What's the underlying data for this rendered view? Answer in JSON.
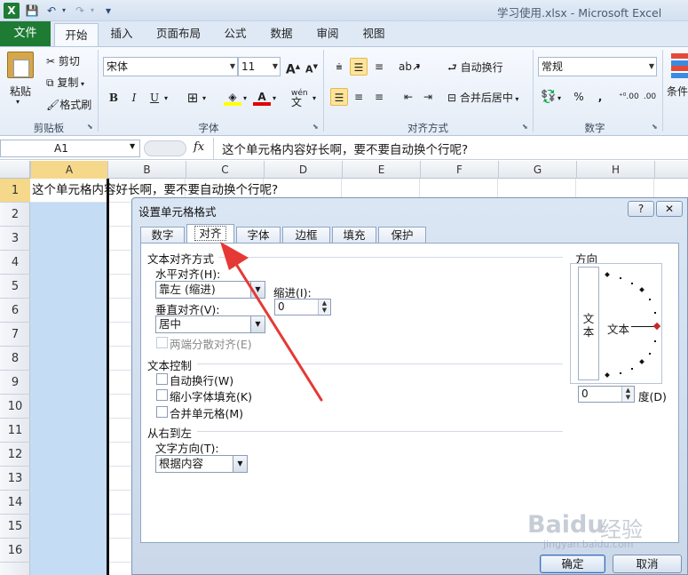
{
  "window": {
    "title": "学习使用.xlsx - Microsoft Excel"
  },
  "quick_access": {
    "save": "💾",
    "undo": "↶",
    "redo": "↷",
    "customize": "▾"
  },
  "ribbon_tabs": [
    {
      "label": "文件"
    },
    {
      "label": "开始"
    },
    {
      "label": "插入"
    },
    {
      "label": "页面布局"
    },
    {
      "label": "公式"
    },
    {
      "label": "数据"
    },
    {
      "label": "审阅"
    },
    {
      "label": "视图"
    }
  ],
  "clipboard": {
    "paste": "粘贴",
    "cut": "剪切",
    "copy": "复制",
    "format_painter": "格式刷",
    "group": "剪贴板"
  },
  "font": {
    "name": "宋体",
    "size": "11",
    "bold": "B",
    "italic": "I",
    "underline": "U",
    "group": "字体",
    "grow": "A",
    "shrink": "A",
    "color_letter": "A",
    "wen": "wén"
  },
  "alignment": {
    "wrap_text": "自动换行",
    "merge_center": "合并后居中",
    "group": "对齐方式"
  },
  "number": {
    "format": "常规",
    "group": "数字",
    "percent": "%",
    "comma": ","
  },
  "styles": {
    "label": "条件"
  },
  "formula_bar": {
    "cell_ref": "A1",
    "fx": "fx",
    "content": "这个单元格内容好长啊，要不要自动换个行呢?"
  },
  "columns": [
    "A",
    "B",
    "C",
    "D",
    "E",
    "F",
    "G",
    "H"
  ],
  "rows": [
    "1",
    "2",
    "3",
    "4",
    "5",
    "6",
    "7",
    "8",
    "9",
    "10",
    "11",
    "12",
    "13",
    "14",
    "15",
    "16"
  ],
  "cell_a1": "这个单元格内容好长啊，要不要自动换个行呢?",
  "dialog": {
    "title": "设置单元格格式",
    "help": "?",
    "close": "✕",
    "tabs": [
      {
        "label": "数字"
      },
      {
        "label": "对齐"
      },
      {
        "label": "字体"
      },
      {
        "label": "边框"
      },
      {
        "label": "填充"
      },
      {
        "label": "保护"
      }
    ],
    "text_alignment": {
      "section": "文本对齐方式",
      "horizontal_label": "水平对齐(H):",
      "horizontal_value": "靠左 (缩进)",
      "indent_label": "缩进(I):",
      "indent_value": "0",
      "vertical_label": "垂直对齐(V):",
      "vertical_value": "居中",
      "justify_distributed": "两端分散对齐(E)"
    },
    "text_control": {
      "section": "文本控制",
      "wrap": "自动换行(W)",
      "shrink": "缩小字体填充(K)",
      "merge": "合并单元格(M)"
    },
    "rtl": {
      "section": "从右到左",
      "direction_label": "文字方向(T):",
      "direction_value": "根据内容"
    },
    "orientation": {
      "section": "方向",
      "vertical_text": "文本",
      "horizontal_text": "文本",
      "degrees_value": "0",
      "degrees_label": "度(D)"
    },
    "ok": "确定",
    "cancel": "取消"
  },
  "watermark": {
    "brand": "Baidu",
    "suffix": "经验",
    "url": "jingyan.baidu.com"
  },
  "colors": {
    "excel_green": "#1e7b34",
    "selected_column": "#c5dcf5",
    "arrow_red": "#e53935"
  }
}
